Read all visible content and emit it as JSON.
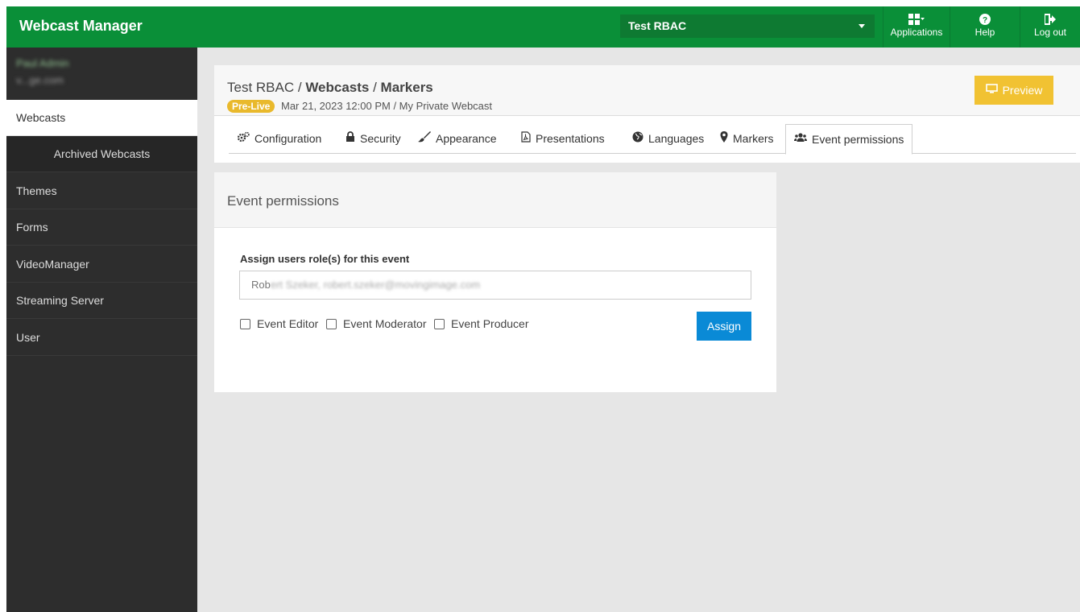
{
  "app": {
    "title": "Webcast Manager"
  },
  "topnav": {
    "context_select": "Test RBAC",
    "applications_label": "Applications",
    "help_label": "Help",
    "logout_label": "Log out"
  },
  "sidebar": {
    "user_name": "Paul Admin",
    "user_email": "v...ge.com",
    "items": [
      {
        "label": "Webcasts"
      },
      {
        "label": "Archived Webcasts"
      },
      {
        "label": "Themes"
      },
      {
        "label": "Forms"
      },
      {
        "label": "VideoManager"
      },
      {
        "label": "Streaming Server"
      },
      {
        "label": "User"
      }
    ]
  },
  "header": {
    "crumb_root": "Test RBAC",
    "crumb_sep1": " / ",
    "crumb_webcasts": "Webcasts",
    "crumb_sep2": " / ",
    "crumb_current": "Markers",
    "status_badge": "Pre-Live",
    "subline": "Mar 21, 2023 12:00 PM / My Private Webcast",
    "preview_label": "Preview"
  },
  "tabs": [
    {
      "label": "Configuration",
      "icon": "cogs-icon"
    },
    {
      "label": "Security",
      "icon": "lock-icon"
    },
    {
      "label": "Appearance",
      "icon": "brush-icon"
    },
    {
      "label": "Presentations",
      "icon": "pdf-file-icon"
    },
    {
      "label": "Languages",
      "icon": "globe-icon"
    },
    {
      "label": "Markers",
      "icon": "map-marker-icon"
    },
    {
      "label": "Event permissions",
      "icon": "users-icon",
      "active": true
    }
  ],
  "permissions": {
    "title": "Event permissions",
    "field_label": "Assign users role(s) for this event",
    "user_value_visible": "Rob",
    "user_value_blurred": "ert Szeker, robert.szeker@movingimage.com",
    "roles": [
      {
        "label": "Event Editor",
        "checked": false
      },
      {
        "label": "Event Moderator",
        "checked": false
      },
      {
        "label": "Event Producer",
        "checked": false
      }
    ],
    "assign_label": "Assign"
  },
  "colors": {
    "brand_green": "#0a8f38",
    "sidebar_dark": "#2d2d2d",
    "badge_yellow": "#e9b92c",
    "preview_yellow": "#f1c232",
    "assign_blue": "#0a8ad6"
  }
}
